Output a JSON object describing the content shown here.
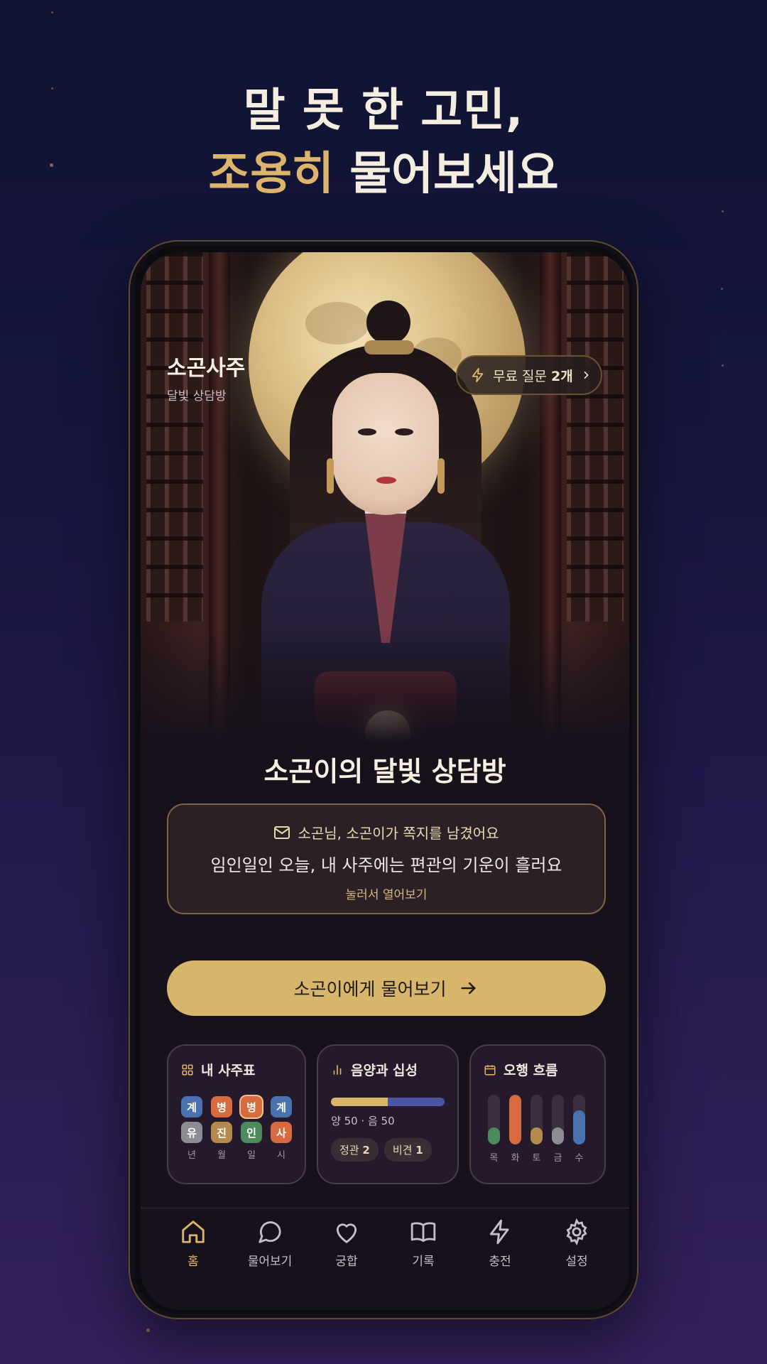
{
  "headline": {
    "line1": "말 못 한 고민,",
    "line2_highlight": "조용히",
    "line2_rest": " 물어보세요"
  },
  "app": {
    "name": "소곤사주",
    "subtitle": "달빛 상담방"
  },
  "free_questions": {
    "prefix": "무료 질문 ",
    "count": "2개"
  },
  "room_title": "소곤이의 달빛 상담방",
  "note": {
    "header": "소곤님, 소곤이가 쪽지를 남겼어요",
    "message": "임인일인 오늘, 내 사주에는 편관의 기운이 흘러요",
    "open_hint": "눌러서 열어보기"
  },
  "ask_button": "소곤이에게 물어보기",
  "cards": {
    "saju": {
      "title": "내 사주표",
      "top_row": [
        "계",
        "병",
        "병",
        "계"
      ],
      "bottom_row": [
        "유",
        "진",
        "인",
        "사"
      ],
      "labels": [
        "년",
        "월",
        "일",
        "시"
      ],
      "top_colors": [
        "#4a72b0",
        "#d76a3f",
        "#d76a3f",
        "#4a72b0"
      ],
      "bottom_colors": [
        "#8c8c92",
        "#b48a4e",
        "#4d8a5c",
        "#d76a3f"
      ]
    },
    "yinyang": {
      "title": "음양과 십성",
      "yang_ratio": 50,
      "text": "양 50 · 음 50",
      "tag1_label": "정관 ",
      "tag1_value": "2",
      "tag2_label": "비견 ",
      "tag2_value": "1"
    },
    "ohaeng": {
      "title": "오행 흐름",
      "elements": [
        {
          "label": "목",
          "value": 35,
          "color": "#4d8a5c"
        },
        {
          "label": "화",
          "value": 100,
          "color": "#d76a3f"
        },
        {
          "label": "토",
          "value": 35,
          "color": "#b48a4e"
        },
        {
          "label": "금",
          "value": 35,
          "color": "#8c8c92"
        },
        {
          "label": "수",
          "value": 68,
          "color": "#4a72b0"
        }
      ]
    }
  },
  "tabs": [
    {
      "label": "홈",
      "icon": "home-icon"
    },
    {
      "label": "물어보기",
      "icon": "chat-bubble-icon"
    },
    {
      "label": "궁합",
      "icon": "heart-icon"
    },
    {
      "label": "기록",
      "icon": "book-icon"
    },
    {
      "label": "충전",
      "icon": "lightning-icon"
    },
    {
      "label": "설정",
      "icon": "gear-icon"
    }
  ],
  "colors": {
    "accent_gold": "#dcb46c",
    "button_gold": "#d7b66c",
    "background": "#17111c"
  }
}
